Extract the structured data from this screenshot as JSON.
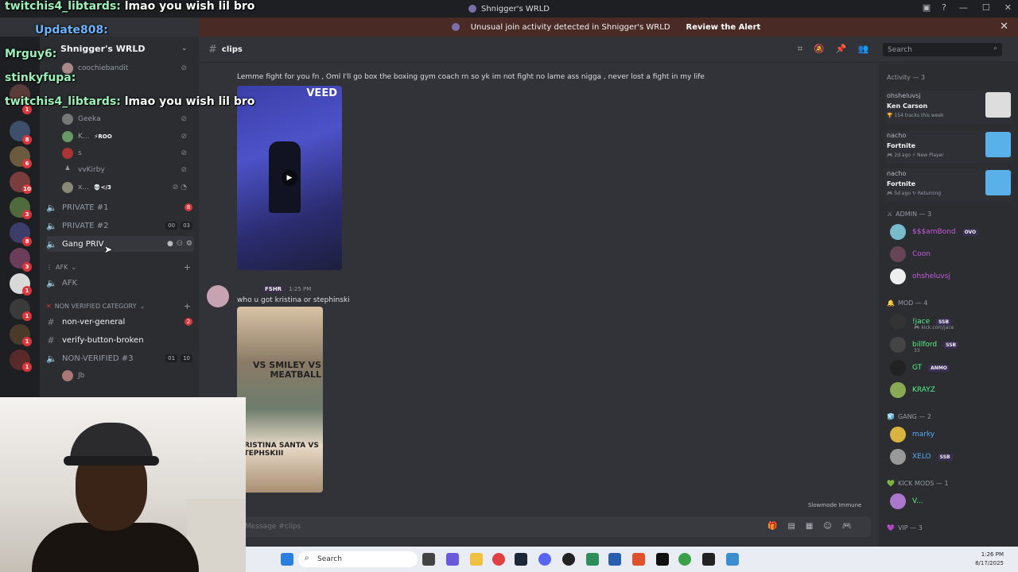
{
  "window": {
    "title": "Shnigger's WRLD",
    "controls": [
      "—",
      "☐",
      "✕"
    ]
  },
  "alert": {
    "text": "Unusual join activity detected in Shnigger's WRLD",
    "action": "Review the Alert"
  },
  "guild_badges": [
    "1",
    "8",
    "6",
    "10",
    "3",
    "8",
    "3",
    "1",
    "1",
    "1",
    "1"
  ],
  "sidebar": {
    "server_name": "Shnigger's WRLD",
    "voice_users_top": [
      {
        "name": "coochiebandit",
        "tag": ""
      },
      {
        "name": "Geeka",
        "tag": ""
      },
      {
        "name": "K...",
        "tag": "⚡ROO"
      },
      {
        "name": "s",
        "tag": ""
      },
      {
        "name": "vvKirby",
        "tag": ""
      },
      {
        "name": "x...",
        "tag": "💀</3"
      }
    ],
    "voice_channels": [
      {
        "name": "PRIVATE #1",
        "badge": "8"
      },
      {
        "name": "PRIVATE #2",
        "count_a": "00",
        "count_b": "03"
      },
      {
        "name": "Gang PRIV"
      }
    ],
    "afk_category": "AFK",
    "afk_channel": "AFK",
    "nonver_category": "NON VERIFIED CATEGORY",
    "nonver_channels": [
      {
        "name": "non-ver-general",
        "badge": "2"
      },
      {
        "name": "verify-button-broken"
      }
    ],
    "nonver_voice": {
      "name": "NON-VERIFIED #3",
      "count_a": "01",
      "count_b": "10"
    },
    "nonver_user": "Jb"
  },
  "chat": {
    "channel": "clips",
    "search_placeholder": "Search",
    "message1": "Lemme fight for you fn , Oml I'll go box the boxing gym coach rn so yk im not fight no lame ass nigga , never lost a fight in my life",
    "video_watermark": "VEED",
    "msg2_tag": "FSHR",
    "msg2_time": "1:25 PM",
    "message2": "who u got kristina or stephinski",
    "poster_title1": "VS SMILEY VS MEATBALL",
    "poster_title2": "KRISTINA SANTA VS STEPHSKIII",
    "slowmode": "Slowmode Immune",
    "composer_placeholder": "Message #clips"
  },
  "members": {
    "activity_header": "Activity — 3",
    "activities": [
      {
        "user": "ohsheluvsj",
        "title": "Ken Carson",
        "meta": "🏆 154 tracks this week"
      },
      {
        "user": "nacho",
        "title": "Fortnite",
        "meta": "🎮 2d ago  ⚡ New Player"
      },
      {
        "user": "nacho",
        "title": "Fortnite",
        "meta": "🎮 5d ago  ↻ Returning"
      }
    ],
    "groups": [
      {
        "label": "ADMIN — 3",
        "icon": "⚔"
      },
      {
        "label": "MOD — 4",
        "icon": "🔔"
      },
      {
        "label": "GANG — 2",
        "icon": "🧊"
      },
      {
        "label": "KICK MODS — 1",
        "icon": "💚"
      },
      {
        "label": "VIP — 3",
        "icon": "💜"
      }
    ],
    "admin": [
      {
        "name": "$$$amBond",
        "tag": "OVO",
        "color": "#c65be0"
      },
      {
        "name": "Coon",
        "tag": "",
        "color": "#c65be0"
      },
      {
        "name": "ohsheluvsj",
        "tag": "",
        "color": "#c65be0"
      }
    ],
    "mod": [
      {
        "name": "!jace",
        "tag": "SSB",
        "sub": "🎮 kick.com/jace",
        "color": "#57f287"
      },
      {
        "name": "billford",
        "tag": "SSB",
        "sub": "33",
        "color": "#57f287"
      },
      {
        "name": "GT",
        "tag": "ANMO",
        "sub": "",
        "color": "#57f287"
      },
      {
        "name": "KRAYZ",
        "tag": "",
        "sub": "",
        "color": "#57f287"
      }
    ],
    "gang": [
      {
        "name": "marky",
        "tag": "",
        "color": "#5aa9f5"
      },
      {
        "name": "XELO",
        "tag": "SSB",
        "color": "#5aa9f5"
      }
    ],
    "kick_mods": [
      {
        "name": "V...",
        "tag": "",
        "color": "#57f287"
      }
    ]
  },
  "stream_overlay": [
    {
      "user": "twitchis4_libtards:",
      "text": "lmao you wish lil bro"
    },
    {
      "user": "Update808:",
      "text": ""
    },
    {
      "user": "Mrguy6:",
      "text": ""
    },
    {
      "user": "stinkyfupa:",
      "text": ""
    },
    {
      "user": "twitchis4_libtards:",
      "text": "lmao you wish lil bro"
    }
  ],
  "taskbar": {
    "search": "Search",
    "time": "1:26 PM",
    "date": "8/17/2025"
  },
  "colors": {
    "accent_red": "#da373c",
    "alert_bg": "#4a2a24",
    "discord_bg": "#313338"
  }
}
